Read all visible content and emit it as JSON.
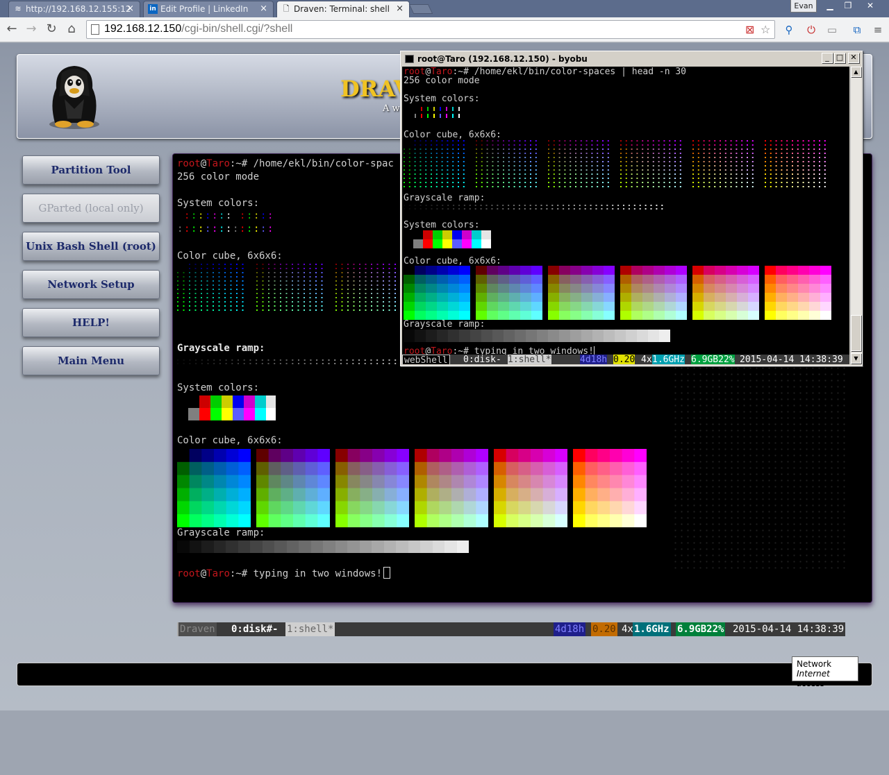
{
  "browser": {
    "tabs": [
      {
        "label": "http://192.168.12.155:12",
        "icon": "wifi-icon"
      },
      {
        "label": "Edit Profile | LinkedIn",
        "icon": "linkedin-icon"
      },
      {
        "label": "Draven: Terminal: shell",
        "icon": "document-icon"
      }
    ],
    "user": "Evan",
    "url_host": "192.168.12.150",
    "url_path": "/cgi-bin/shell.cgi/?shell"
  },
  "page": {
    "brand": "DRAV",
    "tagline": "A we",
    "menu": [
      {
        "label": "Partition Tool",
        "enabled": true
      },
      {
        "label": "GParted (local only)",
        "enabled": false
      },
      {
        "label": "Unix Bash Shell (root)",
        "enabled": true
      },
      {
        "label": "Network Setup",
        "enabled": true
      },
      {
        "label": "HELP!",
        "enabled": true
      },
      {
        "label": "Main Menu",
        "enabled": true
      }
    ]
  },
  "terminal": {
    "prompt_user": "root",
    "prompt_at": "@",
    "prompt_host": "Taro",
    "prompt_rest": ":~# ",
    "command": "/home/ekl/bin/color-spac",
    "lines": {
      "mode": "256 color mode",
      "system_colors": "System colors:",
      "color_cube": "Color cube, 6x6x6:",
      "grayscale": "Grayscale ramp:",
      "system_colors_2": "System colors:",
      "color_cube_2": "Color cube, 6x6x6:",
      "grayscale_2": "Grayscale ramp:"
    },
    "last_command": "typing in two windows!",
    "status": {
      "session": "Draven",
      "window0": "0:disk#-",
      "window1": "1:shell*",
      "uptime": "4d18h",
      "load": "0.20",
      "cpu_count": "4x",
      "cpu_freq": "1.6GHz",
      "mem": "6.9GB22%",
      "datetime": "2015-04-14 14:38:39"
    }
  },
  "byobu": {
    "title": "root@Taro (192.168.12.150) - byobu",
    "command": "/home/ekl/bin/color-spaces | head -n 30",
    "lines": {
      "mode": "256 color mode",
      "system_colors": "System colors:",
      "color_cube": "Color cube, 6x6x6:",
      "grayscale": "Grayscale ramp:",
      "system_colors_2": "System colors:",
      "color_cube_2": "Color cube, 6x6x6:",
      "grayscale_2": "Grayscale ramp:"
    },
    "last_command": "typing in two windows!",
    "status": {
      "session": "webShell",
      "window0": "0:disk-",
      "window1": "1:shell*",
      "uptime": "4d18h",
      "load": "0.20",
      "cpu_count": "4x",
      "cpu_freq": "1.6GHz",
      "mem": "6.9GB22%",
      "datetime": "2015-04-14 14:38:39"
    }
  },
  "tooltip": {
    "title": "Network",
    "detail": "Internet access"
  },
  "colors": {
    "accent_gold": "#f0c323",
    "prompt_red": "#c4161c",
    "menu_text": "#1d2a6b",
    "system": [
      "#000000",
      "#cd0000",
      "#00cd00",
      "#cdcd00",
      "#0000ee",
      "#cd00cd",
      "#00cdcd",
      "#e5e5e5",
      "#7f7f7f",
      "#ff0000",
      "#00ff00",
      "#ffff00",
      "#5c5cff",
      "#ff00ff",
      "#00ffff",
      "#ffffff"
    ]
  }
}
